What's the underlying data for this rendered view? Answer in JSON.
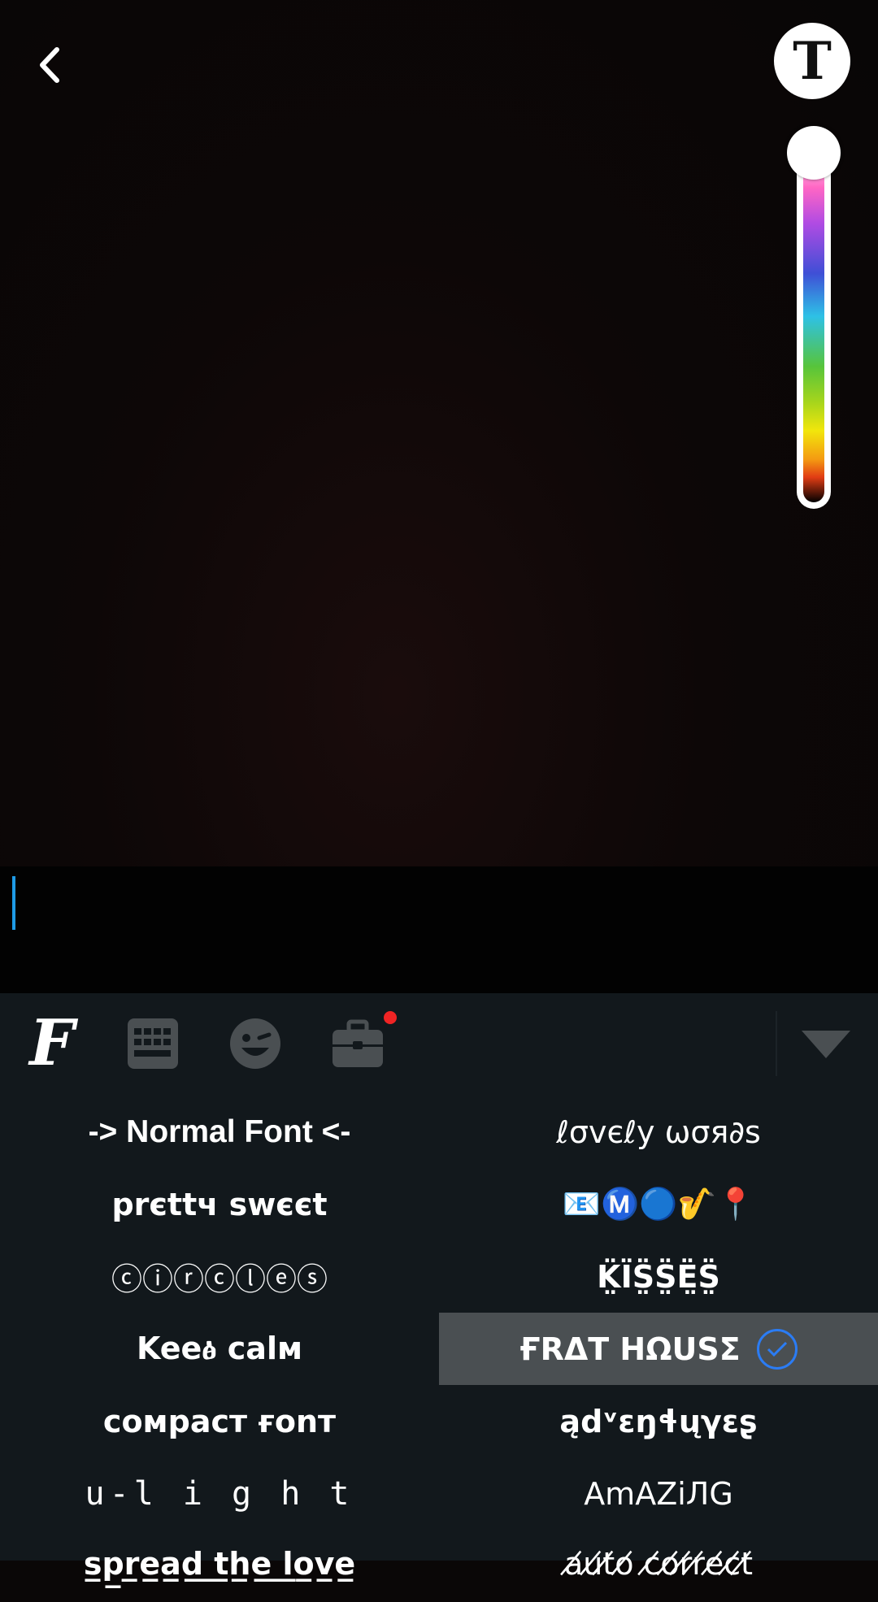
{
  "header": {
    "back_icon": "chevron-left-icon",
    "text_style_label": "T"
  },
  "keyboard": {
    "toolbar": {
      "fonts_label": "F",
      "icons": [
        "keyboard-icon",
        "emoji-wink-icon",
        "briefcase-icon",
        "triangle-down-icon"
      ],
      "badge_color": "#f02424"
    },
    "fonts": [
      {
        "label": "-> Normal Font <-"
      },
      {
        "label": "ℓσvєℓy ωσя∂s"
      },
      {
        "label": "prєttч swєєt"
      },
      {
        "label": "📧Ⓜ️🔵🎷📍"
      },
      {
        "label": "ⓒⓘⓡⓒⓛⓔⓢ"
      },
      {
        "label": "K̤̈ÏS̤̈S̤̈Ë̤S̤̈"
      },
      {
        "label": "Keeፅ calм"
      },
      {
        "label": "ҒRΔT HΩUSΣ",
        "selected": true
      },
      {
        "label": "coмpacт ғonт"
      },
      {
        "label": "ądᵛɛŋɬųγɛʂ"
      },
      {
        "label": "u-l i g h t"
      },
      {
        "label": "AmAZiЛG"
      },
      {
        "label": "s̲p̲r̲e̲a̲d̲ ̲t̲h̲e̲ ̲l̲o̲v̲e̲"
      },
      {
        "label": "a̸u̸t̸o̸ c̸o̸r̸r̸e̸c̸t̸"
      }
    ]
  },
  "colors": {
    "accent": "#1e9be6",
    "selected_bg": "#4a4f52",
    "check": "#2b7cf4"
  }
}
